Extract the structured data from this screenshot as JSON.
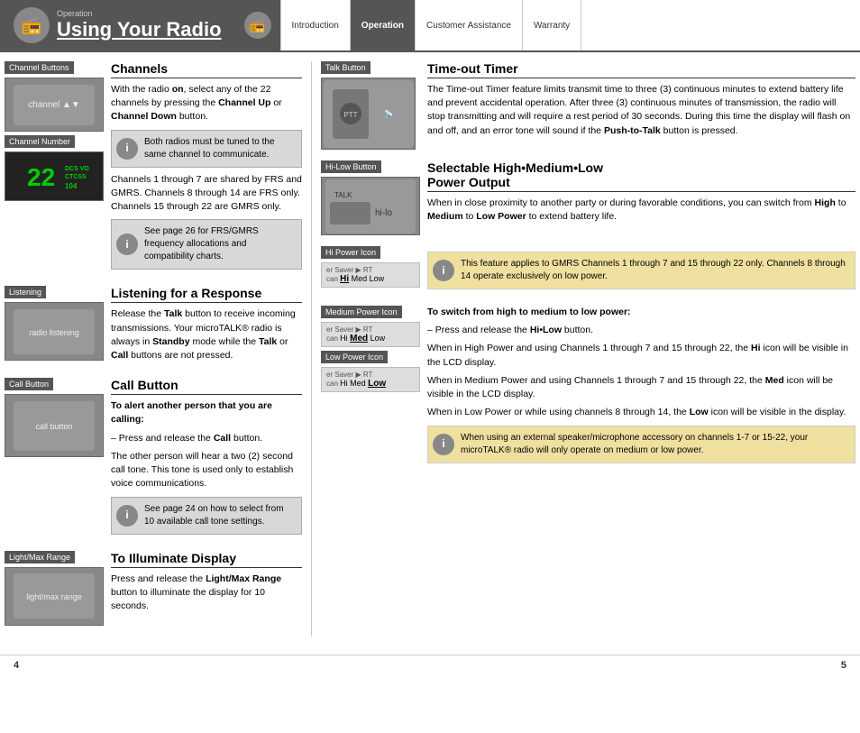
{
  "header": {
    "left_label": "Operation",
    "logo_icon": "📻",
    "title": "Using Your Radio",
    "nav_items": [
      "Introduction",
      "Operation",
      "Customer Assistance",
      "Warranty"
    ],
    "active_nav": "Operation"
  },
  "left": {
    "sections": [
      {
        "id": "channel-buttons",
        "label": "Channel Buttons",
        "image_text": "channel buttons image",
        "title": "Channels",
        "content": [
          "With the radio on, select any of the 22 channels by pressing the Channel Up or Channel Down button."
        ],
        "info_box": "Both radios must be tuned to the same channel to communicate.",
        "extra_text": [
          "Channels 1 through 7 are shared by FRS and GMRS. Channels 8 through 14 are FRS only. Channels 15 through 22 are GMRS only."
        ],
        "info_box2": "See page 26 for FRS/GMRS frequency allocations and compatibility charts."
      },
      {
        "id": "channel-number",
        "label": "Channel Number",
        "image_text": "22 channel display"
      },
      {
        "id": "listening",
        "label": "Listening",
        "image_text": "listening image",
        "title": "Listening for a Response",
        "content": [
          "Release the Talk button to receive incoming transmissions. Your microTALK® radio is always in Standby mode while the Talk or Call buttons are not pressed."
        ]
      },
      {
        "id": "call-button",
        "label": "Call Button",
        "image_text": "call button image",
        "title": "Call Button",
        "subtitle": "To alert another person that you are calling:",
        "steps": [
          "– Press and release the Call button.",
          "The other person will hear a two (2) second call tone. This tone is used only to establish voice communications."
        ],
        "info_box3": "See page 24 on how to select from 10 available call tone settings."
      },
      {
        "id": "light-max-range",
        "label": "Light/Max Range",
        "image_text": "light/max range image",
        "title": "To Illuminate Display",
        "content2": [
          "Press and release the Light/Max Range button to illuminate the display for 10 seconds."
        ]
      }
    ]
  },
  "right": {
    "sections": [
      {
        "id": "talk-button",
        "label": "Talk Button",
        "image_text": "talk button image",
        "title": "Time-out Timer",
        "content": "The Time-out Timer feature limits transmit time to three (3) continuous minutes to extend battery life and prevent accidental operation. After three (3) continuous minutes of transmission, the radio will stop transmitting and will require a rest period of 30 seconds. During this time the display will flash on and off, and an error tone will sound if the Push-to-Talk button is pressed."
      },
      {
        "id": "hi-low-button",
        "label": "Hi-Low Button",
        "image_text": "hi-lo button image",
        "title": "Selectable High•Medium•Low Power Output",
        "content": "When in close proximity to another party or during favorable conditions, you can switch from High to Medium to Low Power to extend battery life."
      },
      {
        "id": "hi-power-icon",
        "label": "Hi Power Icon",
        "image_text": "Hi Med Low",
        "hi_indicator": "Hi",
        "info_box": "This feature applies to GMRS Channels 1 through 7 and 15 through 22 only. Channels 8 through 14 operate exclusively on low power."
      },
      {
        "id": "medium-power-icon",
        "label": "Medium Power Icon",
        "image_text": "Med",
        "med_indicator": "Med"
      },
      {
        "id": "low-power-icon",
        "label": "Low Power Icon",
        "image_text": "Low",
        "low_indicator": "Low"
      },
      {
        "id": "switch-instructions",
        "title": "To switch from high to medium to low power:",
        "steps": [
          "– Press and release the Hi•Low button.",
          "When in High Power and using Channels 1 through 7 and 15 through 22, the Hi icon will be visible in the LCD display.",
          "When in Medium Power and using Channels 1 through 7 and 15 through 22, the Med icon will be visible in the LCD display.",
          "When in Low Power or while using channels 8 through 14, the Low icon will be visible in the display."
        ],
        "info_box": "When using an external speaker/microphone accessory on channels 1-7 or 15-22, your microTALK® radio will only operate on medium or low power."
      }
    ]
  },
  "footer": {
    "page_left": "4",
    "page_right": "5"
  }
}
